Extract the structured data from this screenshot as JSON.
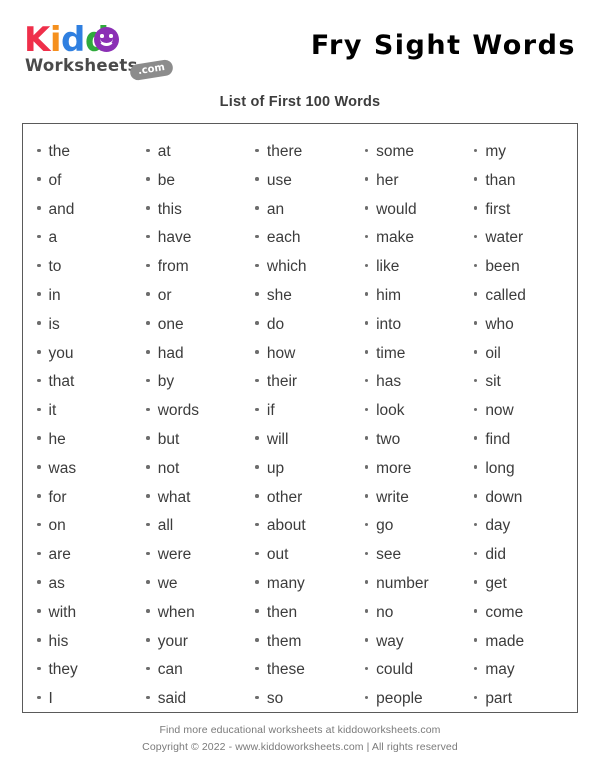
{
  "header": {
    "logo": {
      "brand_part1": "K",
      "brand_part2": "i",
      "brand_part3": "d",
      "brand_part4": "d",
      "brand_part5": "o",
      "brand_word2": "Worksheets",
      "badge": ".com",
      "colors": {
        "k": "#ef2f4a",
        "i": "#f5901e",
        "d1": "#2f7fe0",
        "d2": "#2faa3c",
        "o": "#8b2fb5",
        "worksheets": "#4a4a4a",
        "badge_bg": "#8c8c8c"
      }
    },
    "title": "Fry Sight Words"
  },
  "subtitle": "List of First 100 Words",
  "word_list": {
    "columns": [
      {
        "words": [
          "the",
          "of",
          "and",
          "a",
          "to",
          "in",
          "is",
          "you",
          "that",
          "it",
          "he",
          "was",
          "for",
          "on",
          "are",
          "as",
          "with",
          "his",
          "they",
          "I"
        ]
      },
      {
        "words": [
          "at",
          "be",
          "this",
          "have",
          "from",
          "or",
          "one",
          "had",
          "by",
          "words",
          "but",
          "not",
          "what",
          "all",
          "were",
          "we",
          "when",
          "your",
          "can",
          "said"
        ]
      },
      {
        "words": [
          "there",
          "use",
          "an",
          "each",
          "which",
          "she",
          "do",
          "how",
          "their",
          "if",
          "will",
          "up",
          "other",
          "about",
          "out",
          "many",
          "then",
          "them",
          "these",
          "so"
        ]
      },
      {
        "words": [
          "some",
          "her",
          "would",
          "make",
          "like",
          "him",
          "into",
          "time",
          "has",
          "look",
          "two",
          "more",
          "write",
          "go",
          "see",
          "number",
          "no",
          "way",
          "could",
          "people"
        ]
      },
      {
        "words": [
          "my",
          "than",
          "first",
          "water",
          "been",
          "called",
          "who",
          "oil",
          "sit",
          "now",
          "find",
          "long",
          "down",
          "day",
          "did",
          "get",
          "come",
          "made",
          "may",
          "part"
        ]
      }
    ]
  },
  "footer": {
    "line1": "Find more educational worksheets at kiddoworksheets.com",
    "line2": "Copyright © 2022 - www.kiddoworksheets.com  |  All rights reserved"
  }
}
